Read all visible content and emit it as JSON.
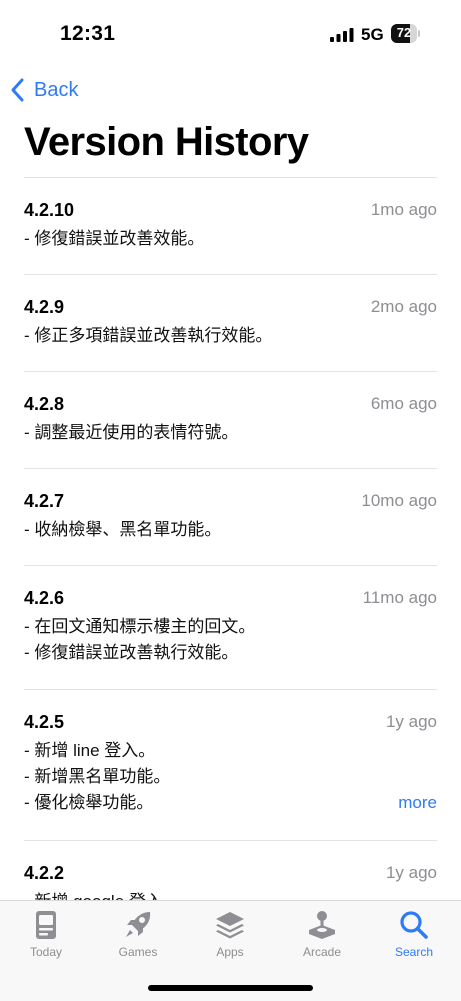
{
  "status_bar": {
    "time": "12:31",
    "network": "5G",
    "battery": "72",
    "battery_level": 0.72
  },
  "nav": {
    "back_label": "Back"
  },
  "page": {
    "title": "Version History"
  },
  "versions": [
    {
      "version": "4.2.10",
      "age": "1mo ago",
      "notes": [
        "- 修復錯誤並改善效能。"
      ]
    },
    {
      "version": "4.2.9",
      "age": "2mo ago",
      "notes": [
        "- 修正多項錯誤並改善執行效能。"
      ]
    },
    {
      "version": "4.2.8",
      "age": "6mo ago",
      "notes": [
        "- 調整最近使用的表情符號。"
      ]
    },
    {
      "version": "4.2.7",
      "age": "10mo ago",
      "notes": [
        "- 收納檢舉、黑名單功能。"
      ]
    },
    {
      "version": "4.2.6",
      "age": "11mo ago",
      "notes": [
        "- 在回文通知標示樓主的回文。",
        "- 修復錯誤並改善執行效能。"
      ]
    },
    {
      "version": "4.2.5",
      "age": "1y ago",
      "notes": [
        "- 新增 line 登入。",
        "- 新增黑名單功能。",
        "- 優化檢舉功能。"
      ],
      "more_label": "more"
    },
    {
      "version": "4.2.2",
      "age": "1y ago",
      "notes": [
        "- 新增 google 登入。"
      ]
    }
  ],
  "tabs": [
    {
      "label": "Today",
      "icon": "today-icon",
      "active": false
    },
    {
      "label": "Games",
      "icon": "games-rocket-icon",
      "active": false
    },
    {
      "label": "Apps",
      "icon": "apps-stack-icon",
      "active": false
    },
    {
      "label": "Arcade",
      "icon": "arcade-joystick-icon",
      "active": false
    },
    {
      "label": "Search",
      "icon": "search-icon",
      "active": true
    }
  ],
  "colors": {
    "accent": "#2f7bf6",
    "secondary_text": "#8e8e93",
    "separator": "#e3e3e6",
    "tab_inactive": "#8e8e93"
  }
}
